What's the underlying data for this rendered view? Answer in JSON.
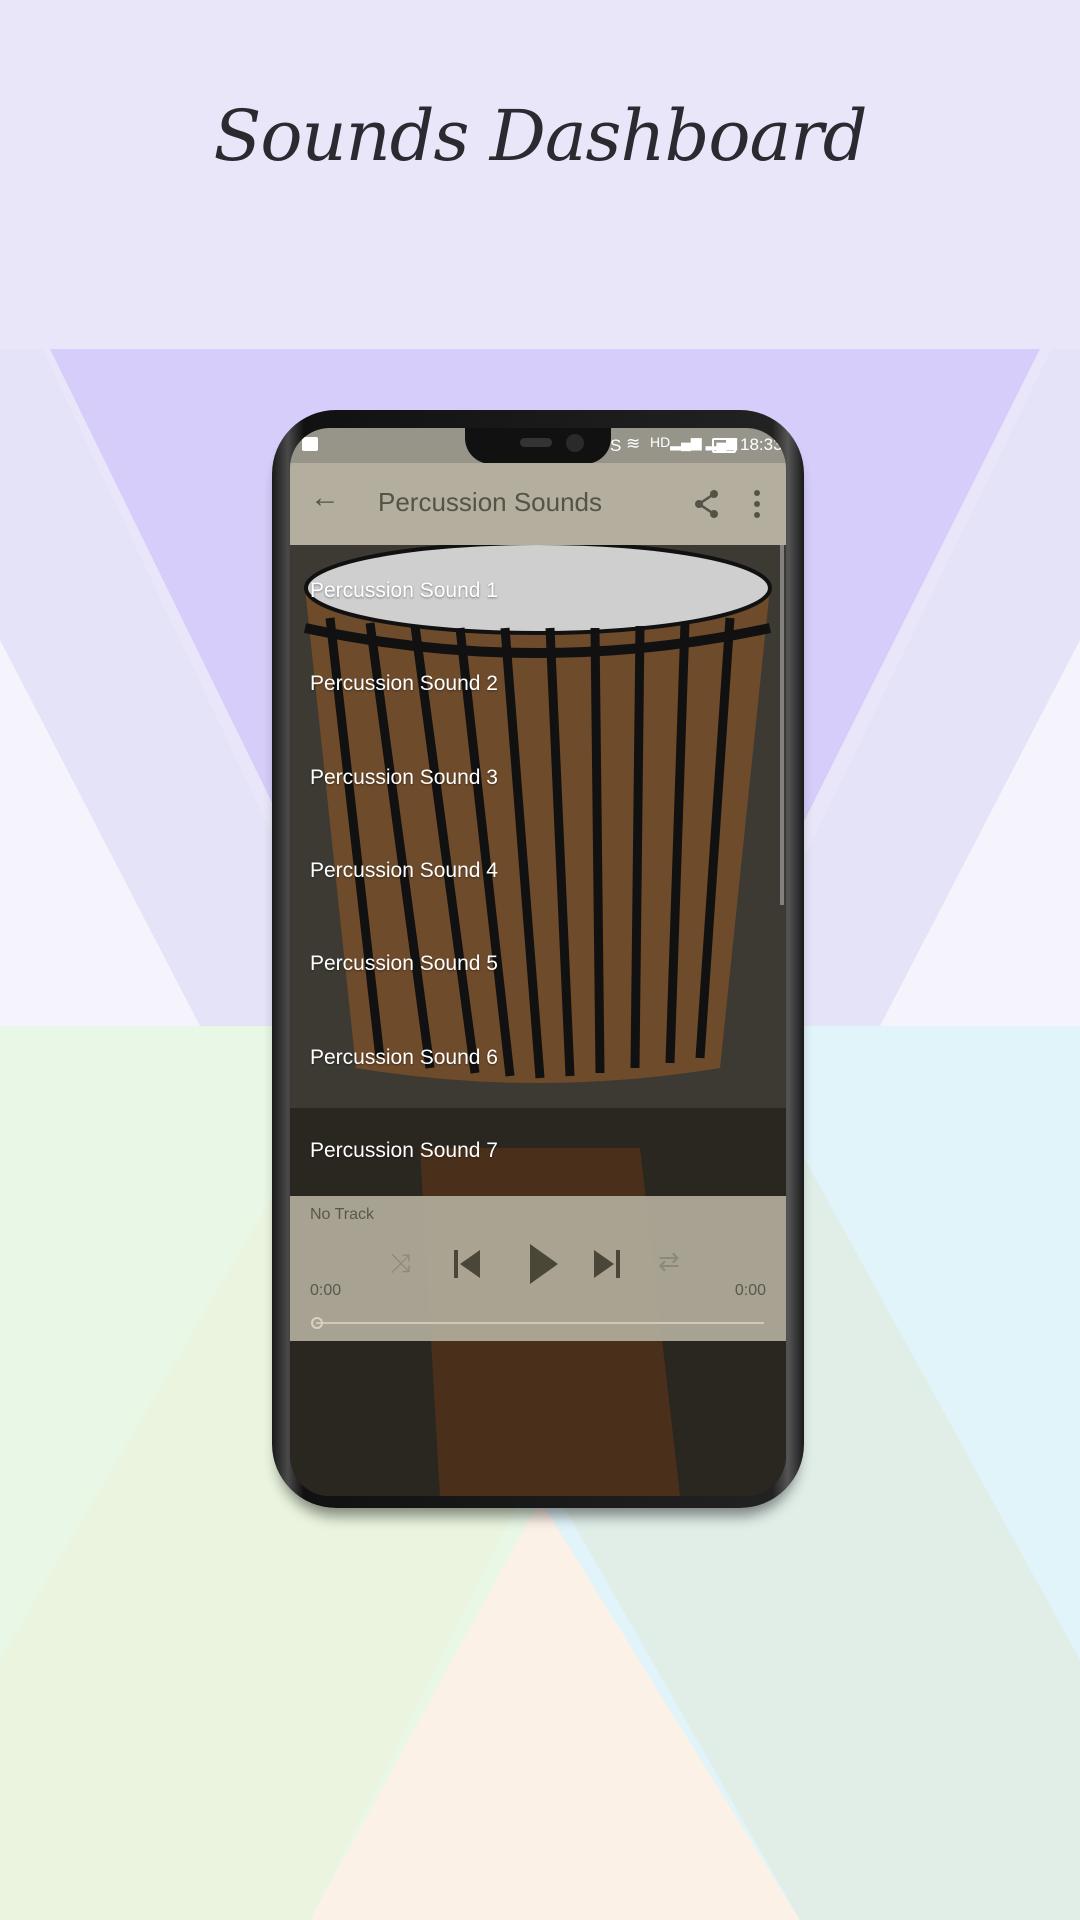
{
  "page": {
    "title": "Sounds Dashboard"
  },
  "status_bar": {
    "time": "18:33",
    "carrier_letter": "S"
  },
  "toolbar": {
    "title": "Percussion Sounds"
  },
  "list": {
    "items": [
      "Percussion Sound 1",
      "Percussion Sound 2",
      "Percussion Sound 3",
      "Percussion Sound 4",
      "Percussion Sound 5",
      "Percussion Sound 6",
      "Percussion Sound 7"
    ]
  },
  "player": {
    "track": "No Track",
    "elapsed": "0:00",
    "duration": "0:00",
    "progress": 0
  },
  "colors": {
    "toolbar": "#b3ae9e",
    "background": "#e8e6f8"
  }
}
